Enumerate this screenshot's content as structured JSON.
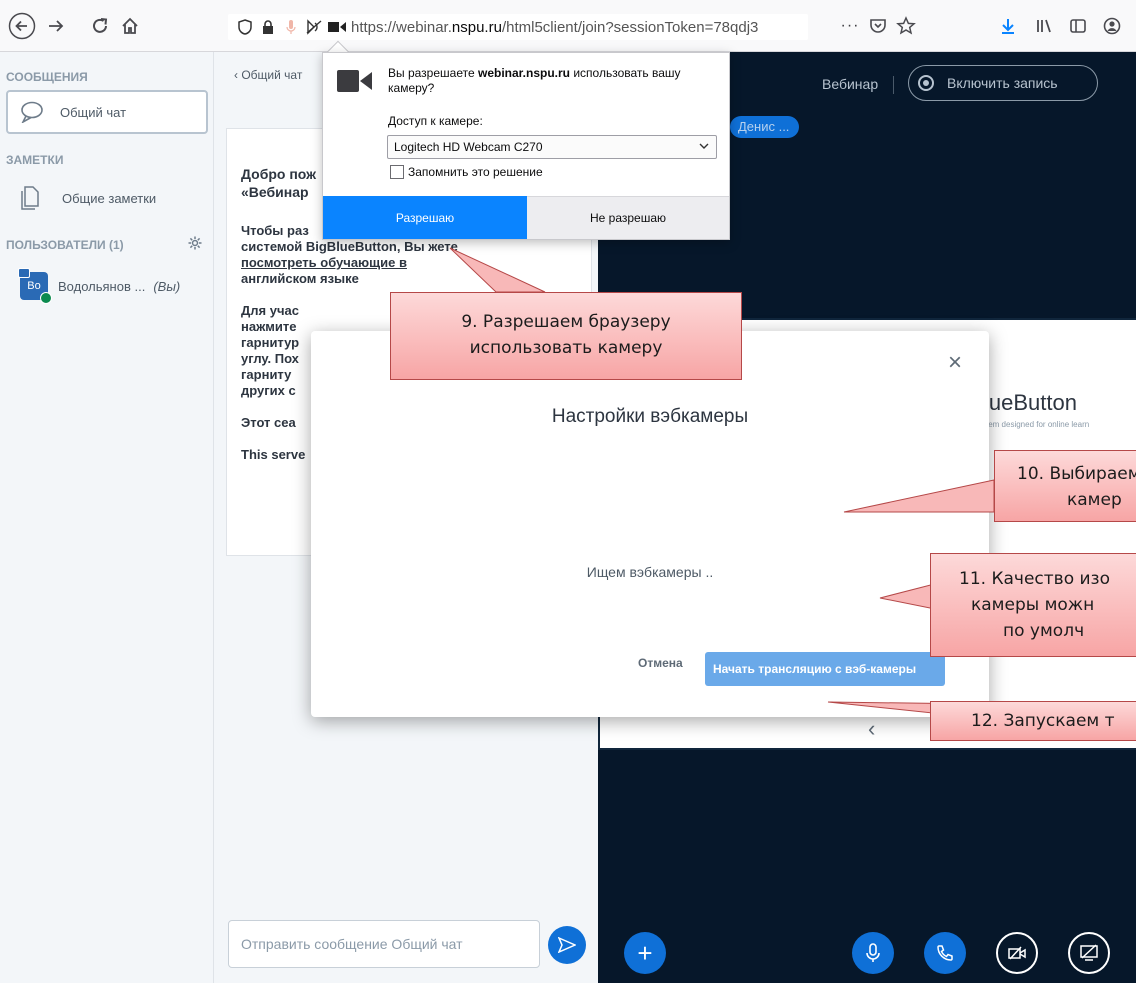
{
  "browser": {
    "url_prefix": "https://webinar.",
    "url_domain": "nspu.ru",
    "url_path": "/html5client/join?sessionToken=78qdj3",
    "overflow_dots": "···"
  },
  "permission_popup": {
    "question_pre": "Вы разрешаете ",
    "question_domain": "webinar.nspu.ru",
    "question_post": " использовать вашу камеру?",
    "access_label": "Доступ к камере:",
    "camera_option": "Logitech HD Webcam C270",
    "remember_label": "Запомнить это решение",
    "remember_checked": false,
    "allow_label": "Разрешаю",
    "deny_label": "Не разрешаю"
  },
  "sidebar": {
    "messages_title": "СООБЩЕНИЯ",
    "public_chat": "Общий чат",
    "notes_title": "ЗАМЕТКИ",
    "shared_notes": "Общие заметки",
    "users_title": "ПОЛЬЗОВАТЕЛИ (1)",
    "user_avatar": "Bo",
    "user_name": "Водольянов ...",
    "user_you": "(Вы)"
  },
  "chat": {
    "header": "Общий чат",
    "line1": "Добро пож",
    "line2": "«Вебинар",
    "line3": "Чтобы раз",
    "line4": "системой BigBlueButton, Вы",
    "line4b": "жете",
    "line5": "посмотреть обучающие в",
    "line6": "английском языке",
    "line7": "Для учас",
    "line8": "нажмите",
    "line9": "гарнитур",
    "line10": "углу. Пох",
    "line11": "гарниту",
    "line12": "других с",
    "line13": "Этот сеа",
    "line14": "This serve",
    "input_placeholder": "Отправить сообщение Общий чат"
  },
  "main": {
    "title": "Вебинар",
    "record_label": "Включить запись",
    "talker": "Денис ...",
    "brand": "lueButton",
    "tagline": "stem designed for online learn"
  },
  "modal": {
    "title": "Настройки вэбкамеры",
    "searching": "Ищем вэбкамеры ..",
    "cancel_label": "Отмена",
    "start_label": "Начать трансляцию с вэб-камеры"
  },
  "callouts": {
    "c9_line1": "9. Разрешаем браузеру",
    "c9_line2": "использовать камеру",
    "c10_line1": "10. Выбираем",
    "c10_line2": "камер",
    "c11_line1": "11. Качество изо",
    "c11_line2": "камеры можн",
    "c11_line3": "по умолч",
    "c12_line1": "12. Запускаем т"
  },
  "colors": {
    "primary": "#0f70d7",
    "dark_bg": "#06172a",
    "firefox_blue": "#0a84ff",
    "callout": "#f7a5a5"
  }
}
